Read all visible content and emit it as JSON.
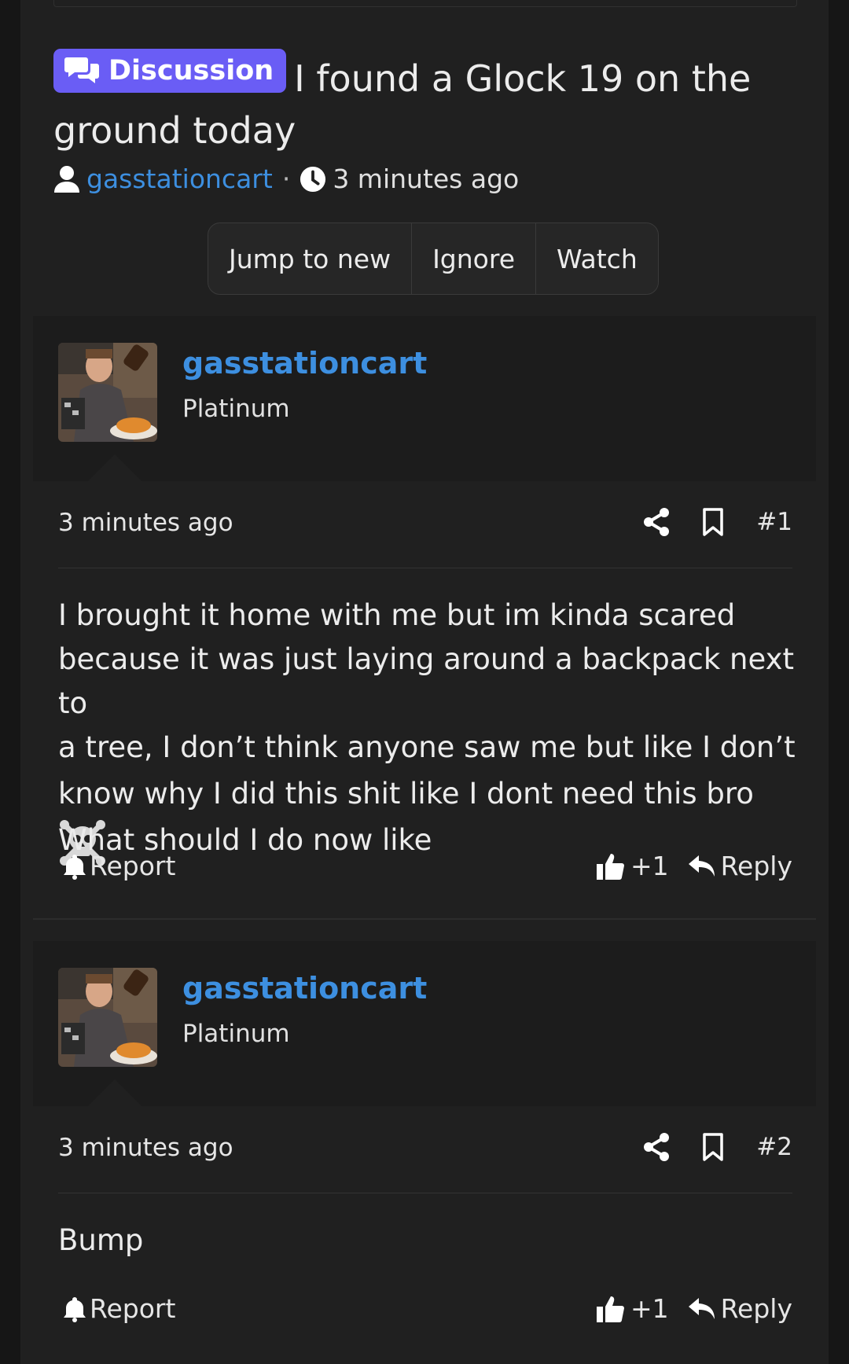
{
  "thread": {
    "prefix": "Discussion",
    "prefix_color": "#6a5df5",
    "title": "I found a Glock 19 on the ground today",
    "author": "gasstationcart",
    "time": "3 minutes ago",
    "separator": "·",
    "user_icon": "user-icon",
    "clock_icon": "clock-icon"
  },
  "buttons": {
    "jump": "Jump to new",
    "ignore": "Ignore",
    "watch": "Watch"
  },
  "posts": [
    {
      "username": "gasstationcart",
      "rank": "Platinum",
      "time": "3 minutes ago",
      "number": "#1",
      "body_lines": [
        "I brought it home with me but im kinda scared",
        "because it was just laying around a backpack next to",
        "a tree, I don’t think anyone saw me but like I don’t",
        "know why I did this shit like I dont need this bro",
        "What should I do now like"
      ],
      "emoji": "skull-crossbones-icon",
      "report": "Report",
      "likes": "+1",
      "reply": "Reply"
    },
    {
      "username": "gasstationcart",
      "rank": "Platinum",
      "time": "3 minutes ago",
      "number": "#2",
      "body_lines": [
        "Bump"
      ],
      "report": "Report",
      "likes": "+1",
      "reply": "Reply"
    }
  ],
  "colors": {
    "link": "#3d8fe0",
    "background": "#202020"
  }
}
